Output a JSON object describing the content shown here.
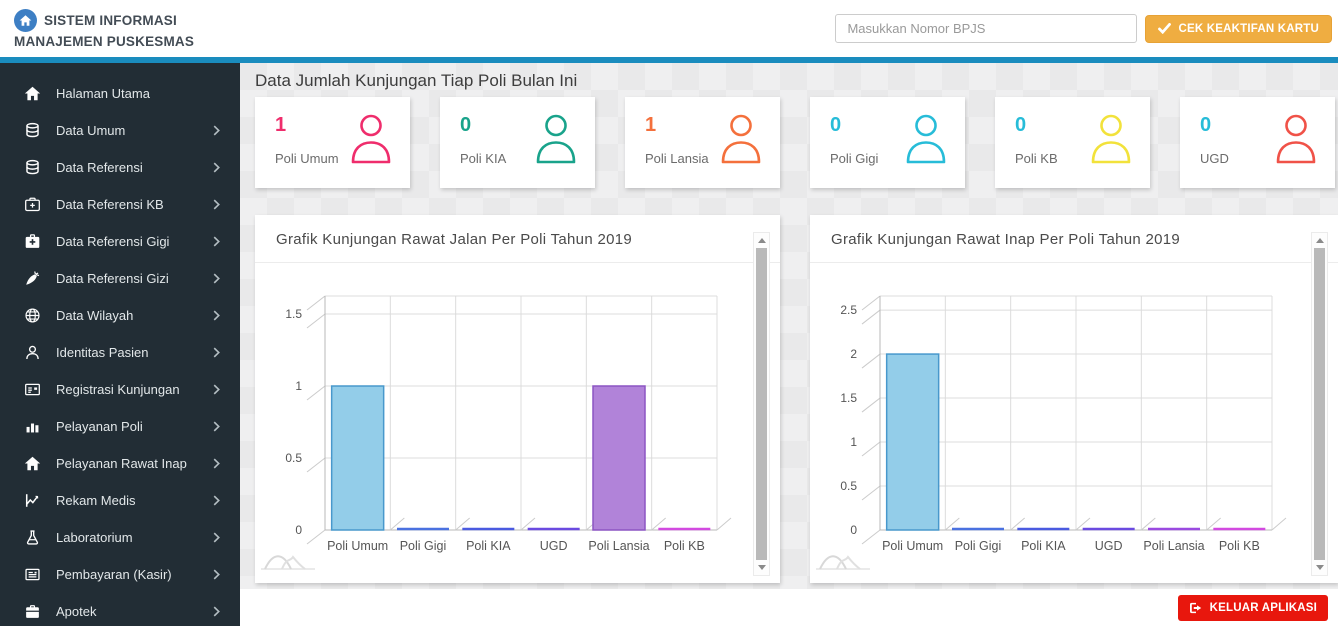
{
  "header": {
    "app_title_line1": "SISTEM INFORMASI",
    "app_title_line2": "MANAJEMEN PUSKESMAS",
    "logo_icon": "home",
    "search_placeholder": "Masukkan Nomor BPJS",
    "check_button_label": "CEK KEAKTIFAN KARTU",
    "check_button_icon": "check",
    "accent_bar_color": "#1a8cbe",
    "check_button_color": "#efad41"
  },
  "sidebar": {
    "bg_color": "#222d35",
    "items": [
      {
        "label": "Halaman Utama",
        "icon": "home",
        "has_submenu": false
      },
      {
        "label": "Data Umum",
        "icon": "database",
        "has_submenu": true
      },
      {
        "label": "Data Referensi",
        "icon": "database",
        "has_submenu": true
      },
      {
        "label": "Data Referensi KB",
        "icon": "medkit",
        "has_submenu": true
      },
      {
        "label": "Data Referensi Gigi",
        "icon": "medkit-solid",
        "has_submenu": true
      },
      {
        "label": "Data Referensi Gizi",
        "icon": "carrot",
        "has_submenu": true
      },
      {
        "label": "Data Wilayah",
        "icon": "globe",
        "has_submenu": true
      },
      {
        "label": "Identitas Pasien",
        "icon": "person",
        "has_submenu": true
      },
      {
        "label": "Registrasi Kunjungan",
        "icon": "id-card",
        "has_submenu": true
      },
      {
        "label": "Pelayanan Poli",
        "icon": "bar-chart",
        "has_submenu": true
      },
      {
        "label": "Pelayanan Rawat Inap",
        "icon": "home",
        "has_submenu": true
      },
      {
        "label": "Rekam Medis",
        "icon": "line-chart",
        "has_submenu": true
      },
      {
        "label": "Laboratorium",
        "icon": "flask",
        "has_submenu": true
      },
      {
        "label": "Pembayaran (Kasir)",
        "icon": "receipt",
        "has_submenu": true
      },
      {
        "label": "Apotek",
        "icon": "briefcase",
        "has_submenu": true
      }
    ]
  },
  "main": {
    "section_title": "Data Jumlah Kunjungan Tiap Poli Bulan Ini",
    "summary_cards": [
      {
        "label": "Poli Umum",
        "value": "1",
        "value_color": "#ef2d6c",
        "icon": "user-outline",
        "icon_color": "#ef2d6c"
      },
      {
        "label": "Poli KIA",
        "value": "0",
        "value_color": "#19a38b",
        "icon": "user-outline",
        "icon_color": "#19a38b"
      },
      {
        "label": "Poli Lansia",
        "value": "1",
        "value_color": "#f4703c",
        "icon": "user-outline",
        "icon_color": "#f4703c"
      },
      {
        "label": "Poli Gigi",
        "value": "0",
        "value_color": "#27bcd8",
        "icon": "user-outline",
        "icon_color": "#27bcd8"
      },
      {
        "label": "Poli KB",
        "value": "0",
        "value_color": "#27bcd8",
        "icon": "user-outline",
        "icon_color": "#f2e23b"
      },
      {
        "label": "UGD",
        "value": "0",
        "value_color": "#27bcd8",
        "icon": "user-outline",
        "icon_color": "#f05248"
      }
    ]
  },
  "chart_data": [
    {
      "type": "bar",
      "title": "Grafik Kunjungan Rawat Jalan Per Poli Tahun 2019",
      "categories": [
        "Poli Umum",
        "Poli Gigi",
        "Poli KIA",
        "UGD",
        "Poli Lansia",
        "Poli KB"
      ],
      "values": [
        1,
        0,
        0,
        0,
        1,
        0
      ],
      "yticks": [
        0,
        0.5,
        1,
        1.5
      ],
      "ylim": [
        0,
        1.625
      ],
      "grid": true,
      "legend": "none",
      "bar_fills": [
        "#93cde9",
        "#4a71e0",
        "#4a5ae0",
        "#6a4ae0",
        "#b183d9",
        "#d24ae0"
      ],
      "bar_strokes": [
        "#4898cc",
        "#4a71e0",
        "#4a5ae0",
        "#6a4ae0",
        "#8c55c3",
        "#d24ae0"
      ]
    },
    {
      "type": "bar",
      "title": "Grafik Kunjungan Rawat Inap Per Poli Tahun 2019",
      "categories": [
        "Poli Umum",
        "Poli Gigi",
        "Poli KIA",
        "UGD",
        "Poli Lansia",
        "Poli KB"
      ],
      "values": [
        2,
        0,
        0,
        0,
        0,
        0
      ],
      "yticks": [
        0,
        0.5,
        1,
        1.5,
        2,
        2.5
      ],
      "ylim": [
        0,
        2.66
      ],
      "grid": true,
      "legend": "none",
      "bar_fills": [
        "#93cde9",
        "#4a71e0",
        "#4a5ae0",
        "#6a4ae0",
        "#9a4ae0",
        "#d24ae0"
      ],
      "bar_strokes": [
        "#4898cc",
        "#4a71e0",
        "#4a5ae0",
        "#6a4ae0",
        "#9a4ae0",
        "#d24ae0"
      ]
    }
  ],
  "footer": {
    "logout_label": "KELUAR APLIKASI",
    "logout_icon": "sign-out",
    "logout_color": "#e8170d"
  }
}
